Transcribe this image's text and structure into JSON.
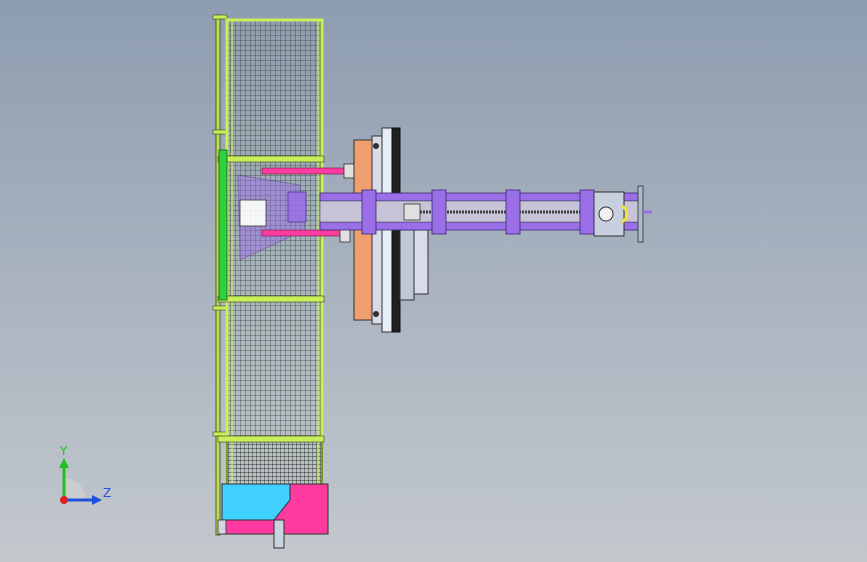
{
  "viewport": {
    "background_top": "#8d9cb0",
    "background_bottom": "#c3c8cd"
  },
  "model": {
    "colors": {
      "frame": "#c6ef5a",
      "mesh": "#3a4a2a",
      "frame_dark": "#7a9a20",
      "purple": "#9b6fe8",
      "purple_dark": "#5a3a9a",
      "orange": "#f0a070",
      "pink": "#ff3aa0",
      "cyan": "#40d0ff",
      "grey": "#d8dce8",
      "dark": "#202020"
    }
  },
  "triad": {
    "y_label": "Y",
    "z_label": "Z",
    "y_color": "#20c020",
    "z_color": "#2050e0",
    "x_color": "#e02020"
  }
}
